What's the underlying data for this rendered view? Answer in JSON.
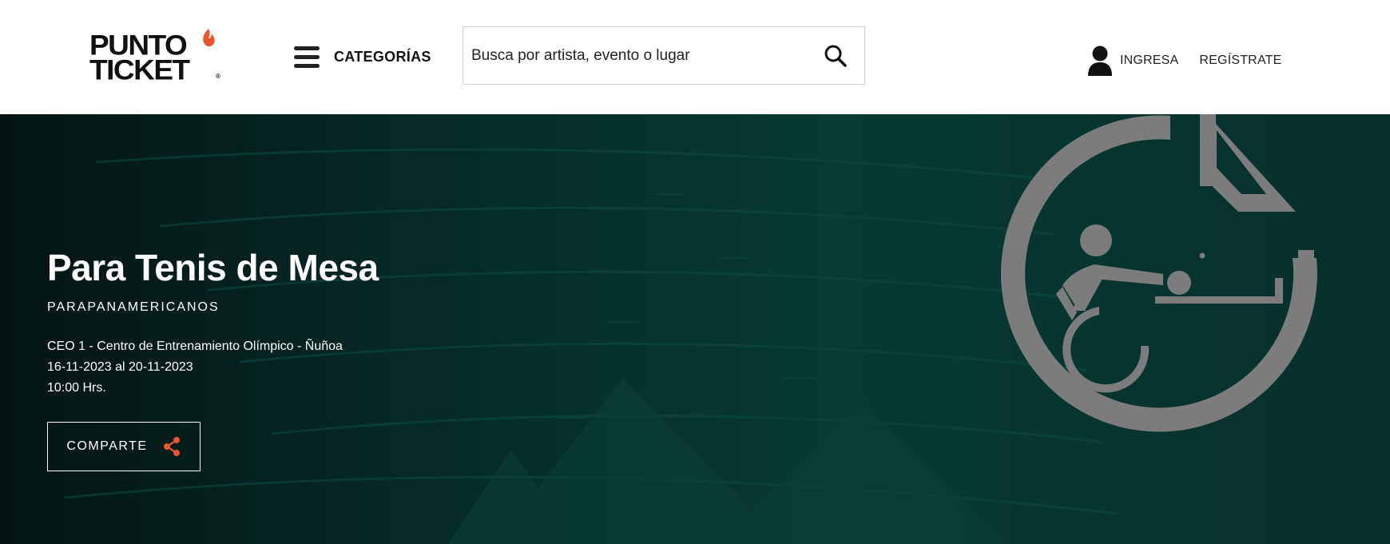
{
  "header": {
    "logo": {
      "line1": "PUNTO",
      "line2": "TICKET",
      "registered": "®"
    },
    "categories_label": "CATEGORÍAS",
    "search": {
      "placeholder": "Busca por artista, evento o lugar",
      "value": ""
    },
    "login_label": "INGRESA",
    "register_label": "REGÍSTRATE"
  },
  "event": {
    "title": "Para Tenis de Mesa",
    "subtitle": "PARAPANAMERICANOS",
    "venue": "CEO 1 - Centro de Entrenamiento Olímpico - Ñuñoa",
    "dates": "16-11-2023 al 20-11-2023",
    "time": "10:00 Hrs.",
    "share_label": "COMPARTE"
  },
  "icons": {
    "menu": "hamburger-icon",
    "search": "search-icon",
    "user": "user-icon",
    "share": "share-icon",
    "emblem": "para-table-tennis-pictogram"
  },
  "colors": {
    "accent": "#e8552e",
    "hero_dark": "#031413",
    "hero_green": "#073a33",
    "emblem_gray": "#7c7c7c",
    "text_dark": "#111111"
  }
}
